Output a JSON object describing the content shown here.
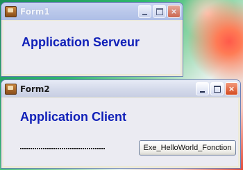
{
  "form1": {
    "title": "Form1",
    "heading": "Application Serveur",
    "buttons": {
      "minimize": "_",
      "maximize": "□",
      "close": "×"
    }
  },
  "form2": {
    "title": "Form2",
    "heading": "Application Client",
    "status_text": "",
    "action_button_label": "Exe_HelloWorld_Fonction",
    "buttons": {
      "minimize": "_",
      "maximize": "□",
      "close": "×"
    }
  },
  "colors": {
    "heading_text": "#0f1fb8",
    "close_button": "#d44a20"
  },
  "icons": {
    "app_icon": "application-icon",
    "minimize": "minimize-icon",
    "maximize": "maximize-icon",
    "close": "close-icon"
  }
}
